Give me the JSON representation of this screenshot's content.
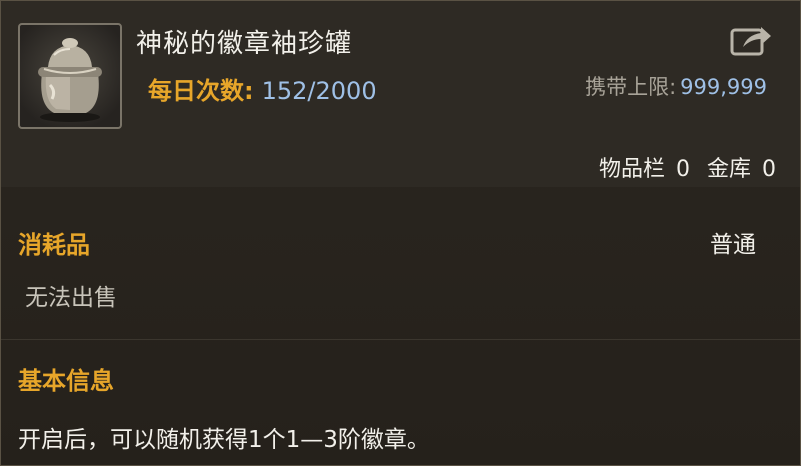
{
  "item": {
    "name": "神秘的徽章袖珍罐",
    "icon": "jar-icon",
    "daily_label": "每日次数:",
    "daily_value": "152/2000",
    "limit_label": "携带上限:",
    "limit_value": "999,999",
    "share_icon": "share-icon"
  },
  "storage": {
    "inventory_label": "物品栏",
    "inventory_count": "0",
    "vault_label": "金库",
    "vault_count": "0"
  },
  "details": {
    "category": "消耗品",
    "rarity": "普通",
    "sell_info": "无法出售"
  },
  "basic_info": {
    "title": "基本信息",
    "description": "开启后，可以随机获得1个1—3阶徽章。"
  },
  "colors": {
    "accent_gold": "#e7a62a",
    "value_blue": "#9fc0e6",
    "text_white": "#f2f0ea",
    "background": "#25211b"
  }
}
